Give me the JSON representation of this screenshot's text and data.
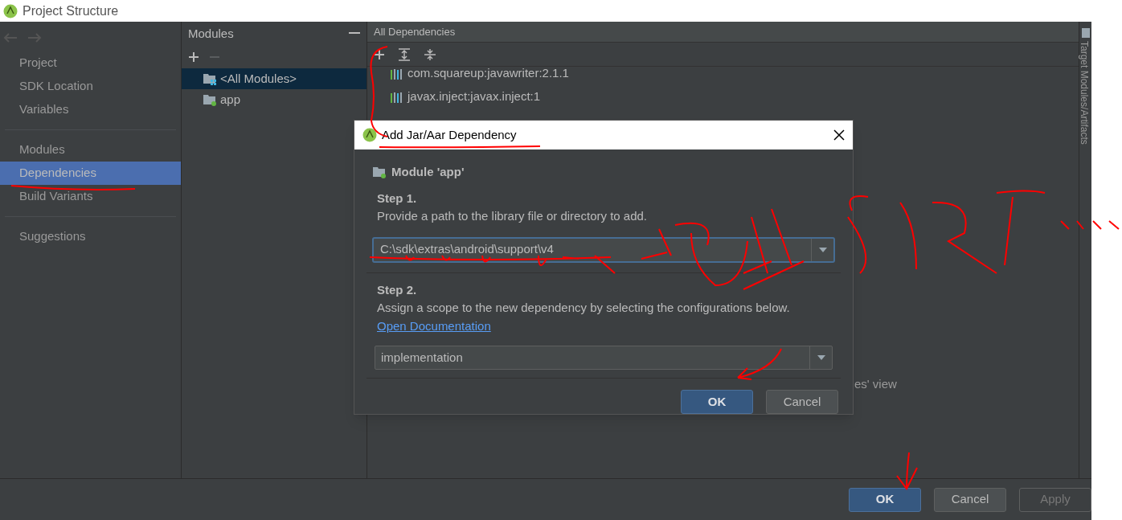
{
  "window": {
    "title": "Project Structure"
  },
  "sidebar": {
    "groups": [
      {
        "items": [
          {
            "label": "Project",
            "selected": false
          },
          {
            "label": "SDK Location",
            "selected": false
          },
          {
            "label": "Variables",
            "selected": false
          }
        ]
      },
      {
        "items": [
          {
            "label": "Modules",
            "selected": false
          },
          {
            "label": "Dependencies",
            "selected": true
          },
          {
            "label": "Build Variants",
            "selected": false
          }
        ]
      },
      {
        "items": [
          {
            "label": "Suggestions",
            "selected": false
          }
        ]
      }
    ]
  },
  "modules": {
    "title": "Modules",
    "items": [
      {
        "label": "<All Modules>",
        "kind": "all",
        "selected": true
      },
      {
        "label": "app",
        "kind": "module",
        "selected": false
      }
    ]
  },
  "dependencies": {
    "title": "All Dependencies",
    "items": [
      "com.squareup:javawriter:2.1.1",
      "javax.inject:javax.inject:1"
    ],
    "hint_fragment": "es' view"
  },
  "side_tab": {
    "label": "Target Modules/Artifacts"
  },
  "dialog": {
    "title": "Add Jar/Aar Dependency",
    "module": "Module 'app'",
    "step1_title": "Step 1.",
    "step1_text": "Provide a path to the library file or directory to add.",
    "path": "C:\\sdk\\extras\\android\\support\\v4",
    "step2_title": "Step 2.",
    "step2_text": "Assign a scope to the new dependency by selecting the configurations below.",
    "link": "Open Documentation",
    "scope": "implementation",
    "buttons": [
      {
        "label": "OK",
        "kind": "primary"
      },
      {
        "label": "Cancel",
        "kind": "normal"
      }
    ]
  },
  "footer": {
    "buttons": [
      {
        "label": "OK",
        "kind": "primary"
      },
      {
        "label": "Cancel",
        "kind": "normal"
      },
      {
        "label": "Apply",
        "kind": "disabled"
      }
    ]
  }
}
